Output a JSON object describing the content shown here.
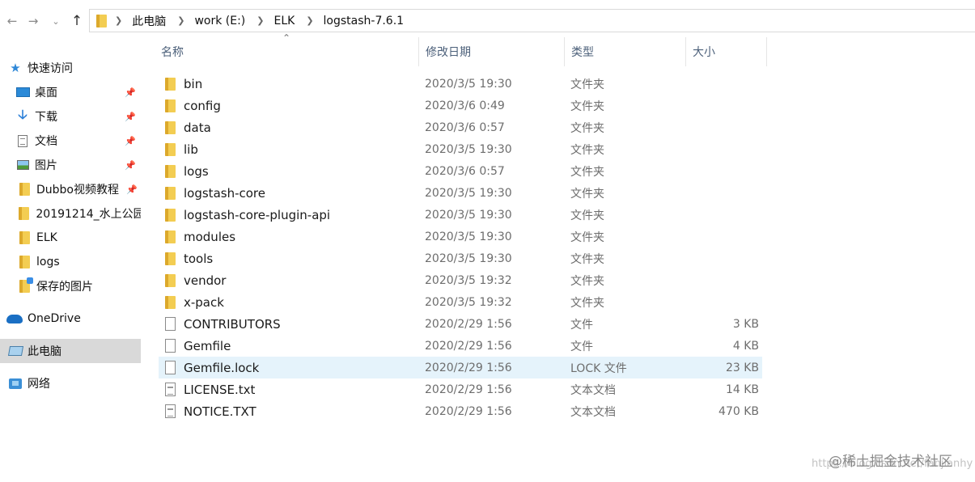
{
  "breadcrumb": [
    "此电脑",
    "work (E:)",
    "ELK",
    "logstash-7.6.1"
  ],
  "nav": {
    "back_icon": "arrow-left-icon",
    "forward_icon": "arrow-right-icon",
    "history_icon": "chevron-down-icon",
    "up_icon": "arrow-up-icon"
  },
  "sidebar": {
    "items": [
      {
        "label": "快速访问",
        "icon": "star-icon",
        "pinned": false
      },
      {
        "label": "桌面",
        "icon": "desktop-icon",
        "pinned": true
      },
      {
        "label": "下载",
        "icon": "download-icon",
        "pinned": true
      },
      {
        "label": "文档",
        "icon": "document-icon",
        "pinned": true
      },
      {
        "label": "图片",
        "icon": "pictures-icon",
        "pinned": true
      },
      {
        "label": "Dubbo视频教程",
        "icon": "folder-icon",
        "pinned": true
      },
      {
        "label": "20191214_水上公园",
        "icon": "folder-icon",
        "pinned": false
      },
      {
        "label": "ELK",
        "icon": "folder-icon",
        "pinned": false
      },
      {
        "label": "logs",
        "icon": "folder-icon",
        "pinned": false
      },
      {
        "label": "保存的图片",
        "icon": "folder-icon",
        "pinned": false
      },
      {
        "label": "OneDrive",
        "icon": "cloud-icon",
        "pinned": false
      },
      {
        "label": "此电脑",
        "icon": "computer-icon",
        "pinned": false,
        "selected": true
      },
      {
        "label": "网络",
        "icon": "network-icon",
        "pinned": false
      }
    ]
  },
  "columns": {
    "name": "名称",
    "date": "修改日期",
    "type": "类型",
    "size": "大小"
  },
  "files": [
    {
      "name": "bin",
      "date": "2020/3/5 19:30",
      "type": "文件夹",
      "size": "",
      "icon": "folder-icon"
    },
    {
      "name": "config",
      "date": "2020/3/6 0:49",
      "type": "文件夹",
      "size": "",
      "icon": "folder-icon"
    },
    {
      "name": "data",
      "date": "2020/3/6 0:57",
      "type": "文件夹",
      "size": "",
      "icon": "folder-icon"
    },
    {
      "name": "lib",
      "date": "2020/3/5 19:30",
      "type": "文件夹",
      "size": "",
      "icon": "folder-icon"
    },
    {
      "name": "logs",
      "date": "2020/3/6 0:57",
      "type": "文件夹",
      "size": "",
      "icon": "folder-icon"
    },
    {
      "name": "logstash-core",
      "date": "2020/3/5 19:30",
      "type": "文件夹",
      "size": "",
      "icon": "folder-icon"
    },
    {
      "name": "logstash-core-plugin-api",
      "date": "2020/3/5 19:30",
      "type": "文件夹",
      "size": "",
      "icon": "folder-icon"
    },
    {
      "name": "modules",
      "date": "2020/3/5 19:30",
      "type": "文件夹",
      "size": "",
      "icon": "folder-icon"
    },
    {
      "name": "tools",
      "date": "2020/3/5 19:30",
      "type": "文件夹",
      "size": "",
      "icon": "folder-icon"
    },
    {
      "name": "vendor",
      "date": "2020/3/5 19:32",
      "type": "文件夹",
      "size": "",
      "icon": "folder-icon"
    },
    {
      "name": "x-pack",
      "date": "2020/3/5 19:32",
      "type": "文件夹",
      "size": "",
      "icon": "folder-icon"
    },
    {
      "name": "CONTRIBUTORS",
      "date": "2020/2/29 1:56",
      "type": "文件",
      "size": "3 KB",
      "icon": "file-icon"
    },
    {
      "name": "Gemfile",
      "date": "2020/2/29 1:56",
      "type": "文件",
      "size": "4 KB",
      "icon": "file-icon"
    },
    {
      "name": "Gemfile.lock",
      "date": "2020/2/29 1:56",
      "type": "LOCK 文件",
      "size": "23 KB",
      "icon": "file-icon",
      "selected": true
    },
    {
      "name": "LICENSE.txt",
      "date": "2020/2/29 1:56",
      "type": "文本文档",
      "size": "14 KB",
      "icon": "text-file-icon"
    },
    {
      "name": "NOTICE.TXT",
      "date": "2020/2/29 1:56",
      "type": "文本文档",
      "size": "470 KB",
      "icon": "text-file-icon"
    }
  ],
  "watermark": {
    "text": "@稀土掘金技术社区",
    "url": "https://blog.csdn.net/fanjianhy"
  }
}
